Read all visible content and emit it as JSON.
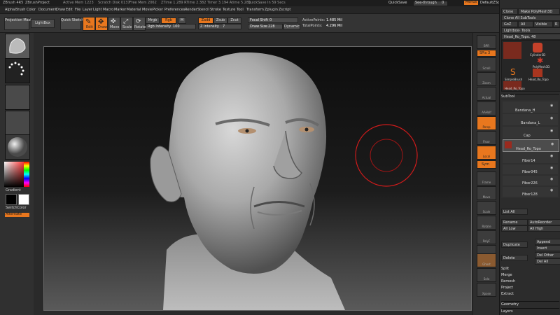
{
  "title_bar": {
    "app": "ZBrush 4R5",
    "project": "ZBrushProject",
    "info_items": [
      "Active Mem 1223",
      "Scratch Disk 0137",
      "Free Mem 2062",
      "ZTime 1.289 RTime 2.382 Timer 3.194 Atime 5.281",
      "QuickSave In 59 Secs"
    ],
    "quicksave": "QuickSave",
    "see_through": "See-through",
    "see_through_value": "0",
    "menus_btn": "Menus",
    "defaultzscript": "DefaultZScript"
  },
  "menus": [
    "Alpha",
    "Brush",
    "Color",
    "Document",
    "Draw",
    "Edit",
    "File",
    "Layer",
    "Light",
    "Macro",
    "Marker",
    "Material",
    "Movie",
    "Picker",
    "Preferences",
    "Render",
    "Stencil",
    "Stroke",
    "Texture",
    "Tool",
    "Transform",
    "Zplugin",
    "Zscript"
  ],
  "toolbar": {
    "projection_master": "Projection Master",
    "lightbox": "LightBox",
    "quick_sketch": "Quick Sketch",
    "edit": "Edit",
    "draw": "Draw",
    "move": "Move",
    "scale": "Scale",
    "rotate": "Rotate",
    "mrgb": "Mrgb",
    "rgb": "Rgb",
    "m": "M",
    "rgb_intensity_label": "Rgb Intensity",
    "rgb_intensity_value": "100",
    "zadd": "Zadd",
    "zsub": "Zsub",
    "zcut": "Zcut",
    "z_intensity_label": "Z Intensity",
    "z_intensity_value": "7",
    "focal_shift_label": "Focal Shift",
    "focal_shift_value": "0",
    "draw_size_label": "Draw Size",
    "draw_size_value": "228",
    "dynamic": "Dynamic",
    "active_points_label": "ActivePoints:",
    "active_points_value": "1.485 Mil",
    "total_points_label": "TotalPoints:",
    "total_points_value": "4.296 Mil"
  },
  "left_shelf": {
    "gradient": "Gradient",
    "switch_color": "SwitchColor",
    "alternate": "Alternate",
    "accent_color": "#e8771e"
  },
  "right_shelf": [
    "BPR",
    "SPix 3",
    "Scroll",
    "Zoom",
    "Actual",
    "AAHalf",
    "Persp",
    "Floor",
    "Local",
    "Sym",
    "Frame",
    "Move",
    "Scale",
    "Rotate",
    "PolyF",
    "Transp",
    "Ghost",
    "Solo",
    "Xpose"
  ],
  "tray": {
    "clone": "Clone",
    "make_polymesh3d": "Make PolyMesh3D",
    "clone_all_subtools": "Clone All SubTools",
    "goz": "GoZ",
    "all": "All",
    "visible": "Visible",
    "r": "R",
    "lightbox_tools": "Lightbox› Tools",
    "current_tool": "Head_Ro_Topo. 48",
    "tool_items": [
      "Cylinder3D",
      "PolyMesh3D",
      "SimpleBrush",
      "Head_Ro_Topo"
    ],
    "subtool_header": "SubTool",
    "subtool_items": [
      "Bandana_H",
      "Bandana_L",
      "Cap",
      "Head_Ro_Topo",
      "Fiber14",
      "Fiber045",
      "Fiber226",
      "Fiber128"
    ],
    "list_all": "List All",
    "rename": "Rename",
    "autoreorder": "AutoReorder",
    "all_low": "All Low",
    "all_high": "All High",
    "duplicate": "Duplicate",
    "append": "Append",
    "insert": "Insert",
    "delete": "Delete",
    "del_other": "Del Other",
    "del_all": "Del All",
    "split": "Split",
    "merge": "Merge",
    "remesh": "Remesh",
    "project": "Project",
    "extract": "Extract",
    "geometry": "Geometry",
    "layers": "Layers"
  }
}
